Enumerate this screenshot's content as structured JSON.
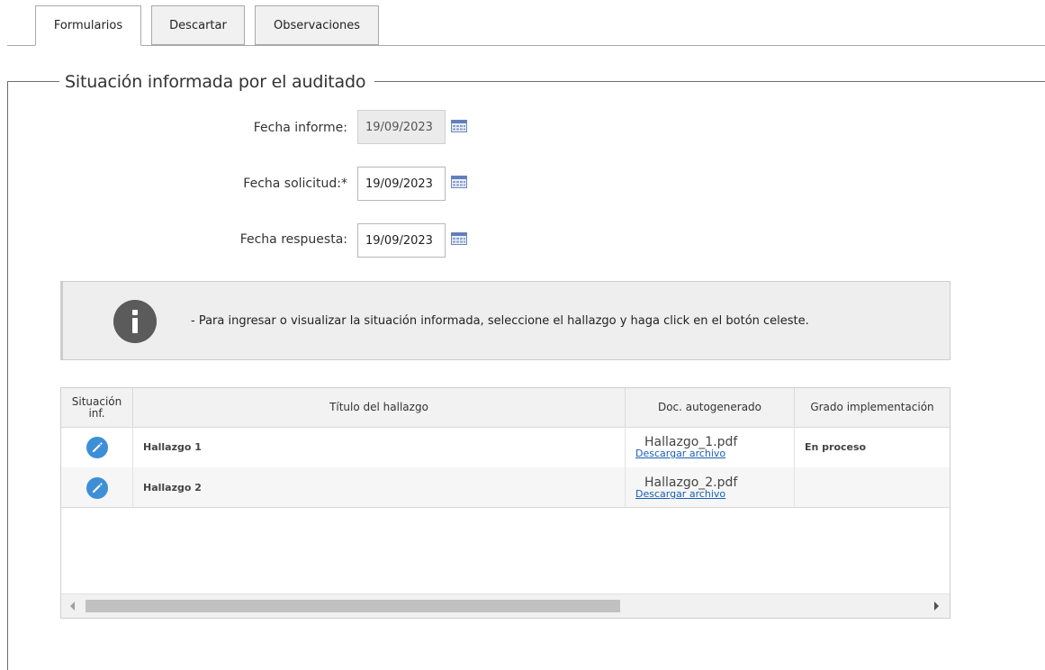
{
  "tabs": [
    {
      "label": "Formularios",
      "active": true
    },
    {
      "label": "Descartar",
      "active": false
    },
    {
      "label": "Observaciones",
      "active": false
    }
  ],
  "section": {
    "title": "Situación informada por el auditado"
  },
  "form": {
    "fecha_informe": {
      "label": "Fecha informe:",
      "value": "19/09/2023",
      "disabled": true
    },
    "fecha_solicitud": {
      "label": "Fecha solicitud:*",
      "value": "19/09/2023"
    },
    "fecha_respuesta": {
      "label": "Fecha respuesta:",
      "value": "19/09/2023"
    }
  },
  "info": {
    "text": "- Para ingresar o visualizar la situación informada, seleccione el hallazgo y haga click en el botón celeste.",
    "icon": "info-icon"
  },
  "grid": {
    "columns": [
      {
        "line1": "Situación",
        "line2": "inf."
      },
      {
        "line1": "Título del hallazgo"
      },
      {
        "line1": "Doc. autogenerado"
      },
      {
        "line1": "Grado implementación"
      }
    ],
    "rows": [
      {
        "titulo": "Hallazgo 1",
        "doc": "Hallazgo_1.pdf",
        "link": "Descargar archivo",
        "grado": "En proceso"
      },
      {
        "titulo": "Hallazgo 2",
        "doc": "Hallazgo_2.pdf",
        "link": "Descargar archivo",
        "grado": ""
      }
    ]
  },
  "colors": {
    "accent_button": "#3d8fd6",
    "link": "#1a5fb4",
    "info_icon": "#5b5b5b"
  }
}
